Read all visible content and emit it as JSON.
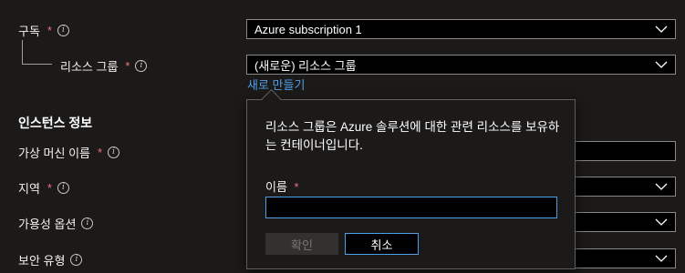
{
  "form": {
    "subscription_label": "구독",
    "subscription_value": "Azure subscription 1",
    "resource_group_label": "리소스 그룹",
    "resource_group_value": "(새로운) 리소스 그룹",
    "create_new_link": "새로 만들기",
    "instance_section_title": "인스턴스 정보",
    "vm_name_label": "가상 머신 이름",
    "region_label": "지역",
    "availability_label": "가용성 옵션",
    "security_type_label": "보안 유형",
    "required_marker": "*",
    "info_glyph": "i"
  },
  "popup": {
    "description": "리소스 그룹은 Azure 솔루션에 대한 관련 리소스를 보유하는 컨테이너입니다.",
    "name_label": "이름",
    "name_value": "",
    "ok_label": "확인",
    "cancel_label": "취소"
  },
  "colors": {
    "background": "#1b1a19",
    "required": "#f1707b",
    "accent": "#4f9ee8"
  }
}
